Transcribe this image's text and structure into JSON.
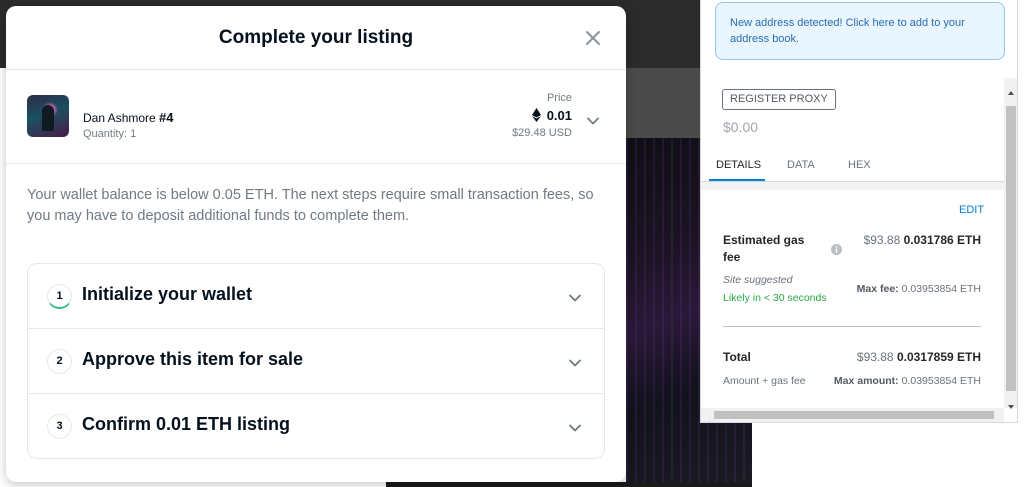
{
  "modal": {
    "title": "Complete your listing",
    "item": {
      "name": "Dan Ashmore",
      "number": "#4",
      "quantity": "Quantity: 1",
      "price_label": "Price",
      "price_eth": "0.01",
      "price_usd": "$29.48 USD"
    },
    "notice": "Your wallet balance is below 0.05 ETH. The next steps require small transaction fees, so you may have to deposit additional funds to complete them.",
    "steps": [
      {
        "number": "1",
        "label": "Initialize your wallet"
      },
      {
        "number": "2",
        "label": "Approve this item for sale"
      },
      {
        "number": "3",
        "label": "Confirm 0.01 ETH listing"
      }
    ]
  },
  "wallet": {
    "address_notice": "New address detected! Click here to add to your address book.",
    "register_proxy": "REGISTER PROXY",
    "usd_value": "$0.00",
    "tabs": [
      "DETAILS",
      "DATA",
      "HEX"
    ],
    "edit": "EDIT",
    "gas": {
      "label": "Estimated gas fee",
      "usd": "$93.88",
      "eth": "0.031786 ETH",
      "site_suggested": "Site suggested",
      "likely": "Likely in < 30 seconds",
      "max_fee_label": "Max fee:",
      "max_fee_value": "0.03953854 ETH"
    },
    "total": {
      "label": "Total",
      "usd": "$93.88",
      "eth": "0.0317859 ETH",
      "sub_label": "Amount + gas fee",
      "max_amount_label": "Max amount:",
      "max_amount_value": "0.03953854 ETH"
    }
  },
  "colors": {
    "step_progress": "#2ebd85",
    "link_blue": "#037dd6",
    "success_green": "#28a745"
  }
}
